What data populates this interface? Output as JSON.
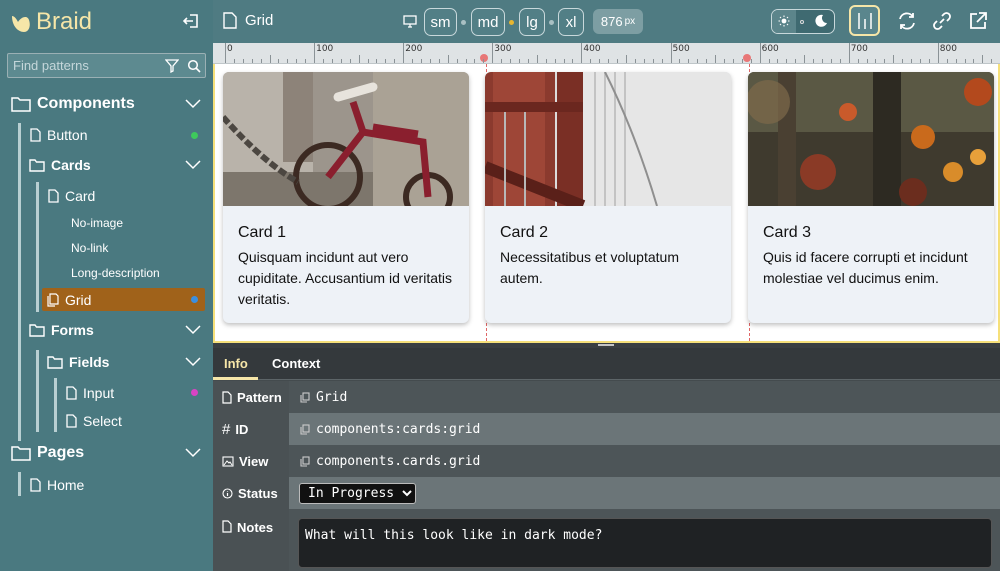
{
  "brand": {
    "name": "Braid"
  },
  "search": {
    "placeholder": "Find patterns"
  },
  "tree": {
    "components": "Components",
    "button": "Button",
    "cards": "Cards",
    "card": "Card",
    "no_image": "No-image",
    "no_link": "No-link",
    "long_description": "Long-description",
    "grid": "Grid",
    "forms": "Forms",
    "fields": "Fields",
    "input": "Input",
    "select": "Select",
    "pages": "Pages",
    "home": "Home"
  },
  "status_colors": {
    "button": "#3ec95c",
    "grid": "#3b8fe0",
    "input": "#d943c4"
  },
  "toolbar": {
    "file_name": "Grid",
    "breakpoints": [
      "sm",
      "md",
      "lg",
      "xl"
    ],
    "width_value": "876",
    "width_unit": "px"
  },
  "ruler": {
    "labels": [
      "0",
      "100",
      "200",
      "300",
      "400",
      "500",
      "600",
      "700",
      "800"
    ]
  },
  "cards": [
    {
      "title": "Card 1",
      "text": "Quisquam incidunt aut vero cupiditate. Accusantium id veritatis veritatis."
    },
    {
      "title": "Card 2",
      "text": "Necessitatibus et voluptatum autem."
    },
    {
      "title": "Card 3",
      "text": "Quis id facere corrupti et incidunt molestiae vel ducimus enim."
    }
  ],
  "info": {
    "tabs": [
      "Info",
      "Context"
    ],
    "pattern_label": "Pattern",
    "pattern_value": "Grid",
    "id_label": "ID",
    "id_value": "components:cards:grid",
    "view_label": "View",
    "view_value": "components.cards.grid",
    "status_label": "Status",
    "status_value": "In Progress",
    "notes_label": "Notes",
    "notes_value": "What will this look like in dark mode?"
  },
  "colors": {
    "accent": "#f6e6a8",
    "selected": "#a0621a"
  }
}
